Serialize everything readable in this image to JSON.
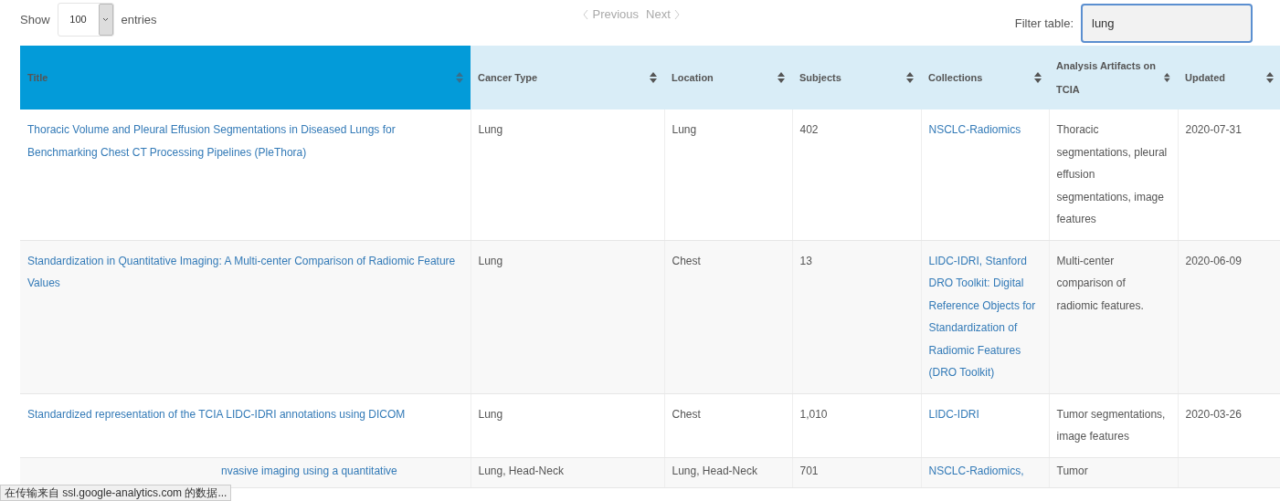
{
  "length_menu": {
    "before": "Show",
    "value": "100",
    "after": "entries"
  },
  "pager": {
    "previous": {
      "label": "Previous",
      "disabled": true
    },
    "next": {
      "label": "Next",
      "disabled": true
    }
  },
  "filter": {
    "label": "Filter table:",
    "value": "lung"
  },
  "table": {
    "columns": [
      {
        "label": "Title",
        "highlighted": true
      },
      {
        "label": "Cancer Type",
        "highlighted": false
      },
      {
        "label": "Location",
        "highlighted": false
      },
      {
        "label": "Subjects",
        "highlighted": false
      },
      {
        "label": "Collections",
        "highlighted": false
      },
      {
        "label": "Analysis Artifacts on TCIA",
        "highlighted": false
      },
      {
        "label": "Updated",
        "highlighted": false
      }
    ],
    "rows": [
      {
        "title": "Thoracic Volume and Pleural Effusion Segmentations in Diseased Lungs for Benchmarking Chest CT Processing Pipelines (PleThora)",
        "cancer_type": "Lung",
        "location": "Lung",
        "subjects": "402",
        "collections": "NSCLC-Radiomics",
        "artifacts": "Thoracic segmentations, pleural effusion segmentations, image features",
        "updated": "2020-07-31"
      },
      {
        "title": "Standardization in Quantitative Imaging: A Multi-center Comparison of Radiomic Feature Values",
        "cancer_type": "Lung",
        "location": "Chest",
        "subjects": "13",
        "collections": "LIDC-IDRI, Stanford DRO Toolkit: Digital Reference Objects for Standardization of Radiomic Features (DRO Toolkit)",
        "artifacts": "Multi-center comparison of radiomic features.",
        "updated": "2020-06-09"
      },
      {
        "title": "Standardized representation of the TCIA LIDC-IDRI annotations using DICOM",
        "cancer_type": "Lung",
        "location": "Chest",
        "subjects": "1,010",
        "collections": "LIDC-IDRI",
        "artifacts": "Tumor segmentations, image features",
        "updated": "2020-03-26"
      },
      {
        "title": "nvasive imaging using a quantitative",
        "cancer_type": "Lung, Head-Neck",
        "location": "Lung, Head-Neck",
        "subjects": "701",
        "collections": "NSCLC-Radiomics,",
        "artifacts": "Tumor"
      }
    ]
  },
  "status_bar": {
    "text": "在传输来自 ssl.google-analytics.com 的数据..."
  }
}
